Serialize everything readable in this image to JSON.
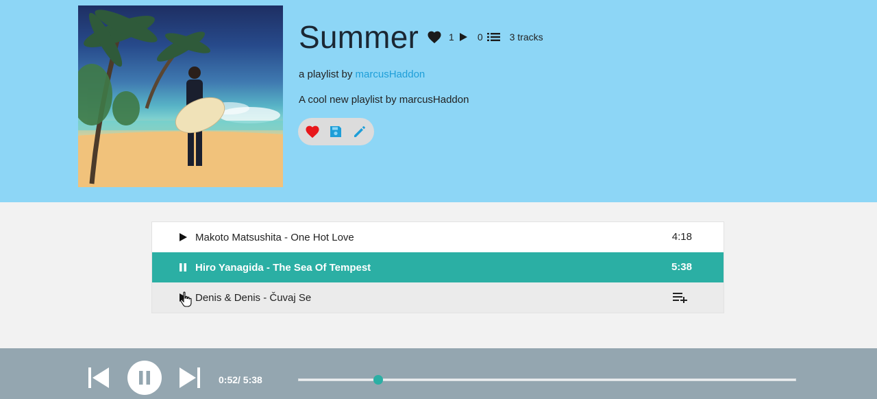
{
  "playlist": {
    "title": "Summer",
    "likes": "1",
    "plays": "0",
    "track_count_label": "3 tracks",
    "byline_prefix": "a playlist by",
    "owner": "marcusHaddon",
    "description": "A cool new playlist by marcusHaddon"
  },
  "actions": {
    "icons": [
      "heart-icon",
      "save-icon",
      "edit-icon"
    ]
  },
  "tracks": [
    {
      "label": "Makoto Matsushita - One Hot Love",
      "duration": "4:18",
      "state": "idle"
    },
    {
      "label": "Hiro Yanagida - The Sea Of Tempest",
      "duration": "5:38",
      "state": "playing"
    },
    {
      "label": "Denis & Denis - Čuvaj Se",
      "duration": "",
      "state": "hover"
    }
  ],
  "player": {
    "elapsed": "0:52",
    "total": "5:38",
    "time_label": "0:52/ 5:38",
    "progress": 0.16
  },
  "colors": {
    "header_bg": "#8dd6f6",
    "accent": "#2bafa4",
    "link": "#1e9ed8",
    "like_red": "#e8171b",
    "player_bg": "#94a6b0"
  }
}
